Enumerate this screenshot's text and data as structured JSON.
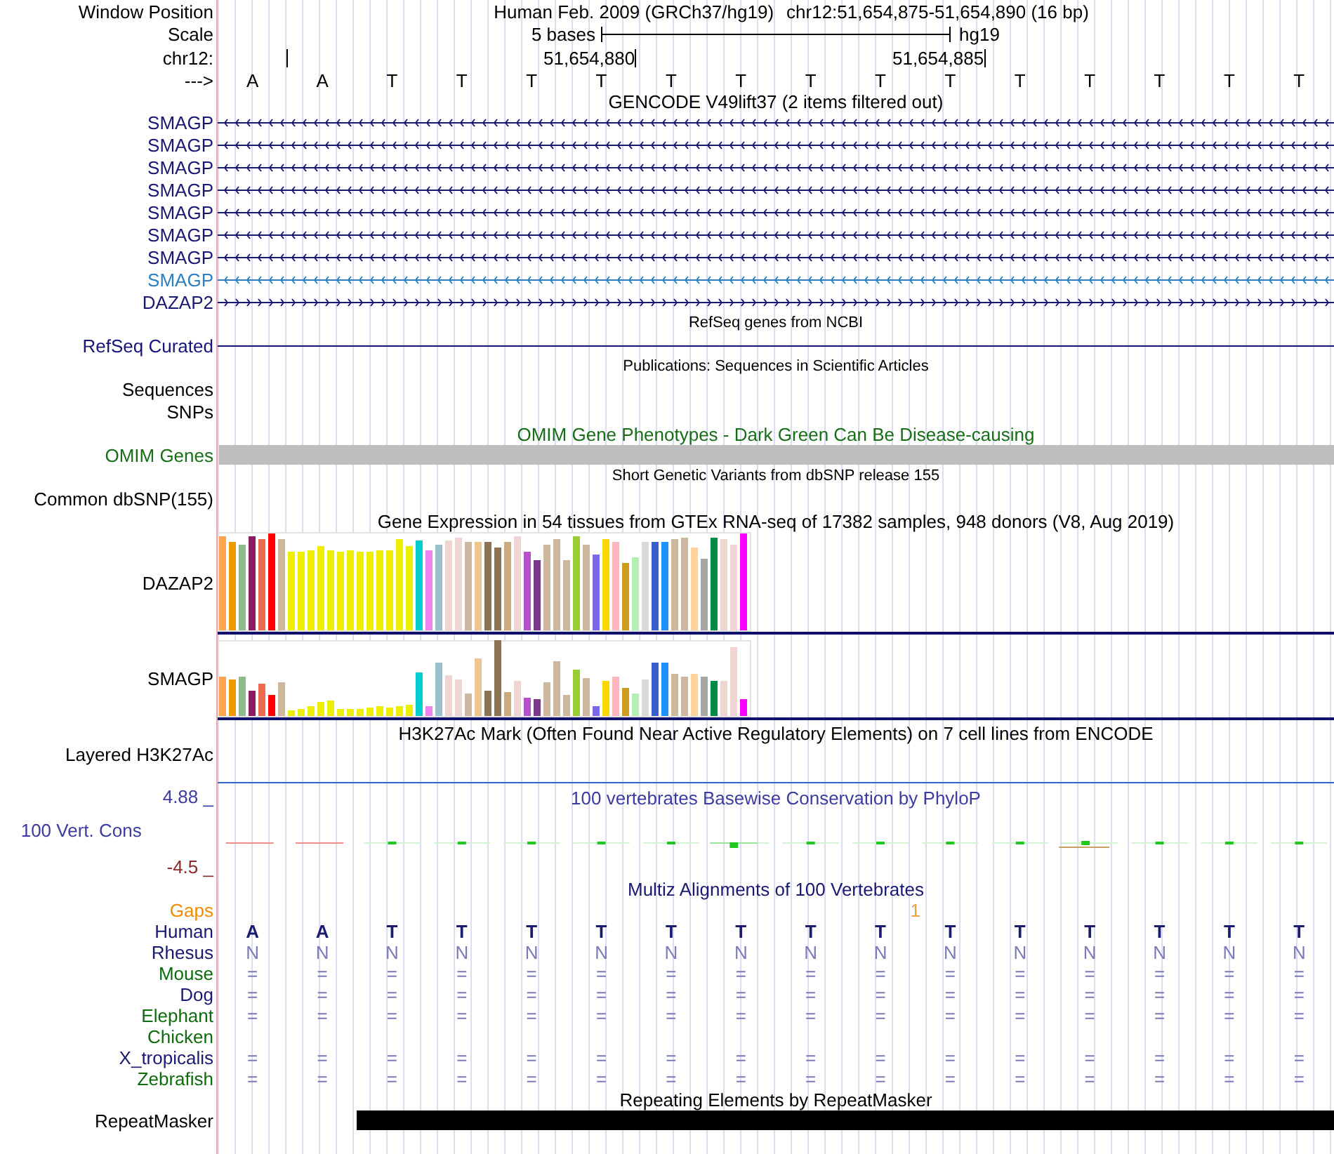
{
  "header": {
    "label": "Window Position",
    "assembly": "Human Feb. 2009 (GRCh37/hg19)",
    "position": "chr12:51,654,875-51,654,890 (16 bp)"
  },
  "scale": {
    "label": "Scale",
    "bar_label": "5 bases",
    "assembly": "hg19"
  },
  "ruler": {
    "label": "chr12:",
    "ticks": [
      {
        "kind": "minor"
      },
      {
        "kind": "major",
        "label": "51,654,880"
      },
      {
        "kind": "major",
        "label": "51,654,885"
      }
    ]
  },
  "sequence": {
    "label": "--->",
    "bases": [
      "A",
      "A",
      "T",
      "T",
      "T",
      "T",
      "T",
      "T",
      "T",
      "T",
      "T",
      "T",
      "T",
      "T",
      "T",
      "T"
    ]
  },
  "gencode": {
    "title": "GENCODE V49lift37 (2 items filtered out)",
    "transcripts": [
      {
        "name": "SMAGP",
        "color": "#191970",
        "reverse": true
      },
      {
        "name": "SMAGP",
        "color": "#191970",
        "reverse": true
      },
      {
        "name": "SMAGP",
        "color": "#191970",
        "reverse": true
      },
      {
        "name": "SMAGP",
        "color": "#191970",
        "reverse": true
      },
      {
        "name": "SMAGP",
        "color": "#191970",
        "reverse": true
      },
      {
        "name": "SMAGP",
        "color": "#191970",
        "reverse": true
      },
      {
        "name": "SMAGP",
        "color": "#191970",
        "reverse": true
      },
      {
        "name": "SMAGP",
        "color": "#2d7fc1",
        "reverse": true
      },
      {
        "name": "DAZAP2",
        "color": "#191970",
        "reverse": false
      }
    ]
  },
  "refseq": {
    "title": "RefSeq genes from NCBI",
    "label": "RefSeq Curated"
  },
  "publications": {
    "title": "Publications: Sequences in Scientific Articles",
    "subtracks": [
      "Sequences",
      "SNPs"
    ]
  },
  "omim": {
    "title": "OMIM Gene Phenotypes - Dark Green Can Be Disease-causing",
    "label": "OMIM Genes"
  },
  "dbsnp": {
    "title": "Short Genetic Variants from dbSNP release 155",
    "label": "Common dbSNP(155)"
  },
  "gtex": {
    "title": "Gene Expression in 54 tissues from GTEx RNA-seq of 17382 samples, 948 donors (V8, Aug 2019)",
    "genes": [
      "DAZAP2",
      "SMAGP"
    ]
  },
  "h3k27ac": {
    "title": "H3K27Ac Mark (Often Found Near Active Regulatory Elements) on 7 cell lines from ENCODE",
    "label": "Layered H3K27Ac"
  },
  "phylop": {
    "title": "100 vertebrates Basewise Conservation by PhyloP",
    "label": "100 Vert. Cons",
    "max_label": "4.88 _",
    "min_label": "-4.5 _"
  },
  "multiz": {
    "title": "Multiz Alignments of 100 Vertebrates",
    "gaps": {
      "label": "Gaps",
      "count": "1"
    },
    "species": [
      {
        "name": "Human",
        "color": "#191970",
        "kind": "reference",
        "bases": [
          "A",
          "A",
          "T",
          "T",
          "T",
          "T",
          "T",
          "T",
          "T",
          "T",
          "T",
          "T",
          "T",
          "T",
          "T",
          "T"
        ]
      },
      {
        "name": "Rhesus",
        "color": "#191970",
        "kind": "aligned",
        "bases": [
          "N",
          "N",
          "N",
          "N",
          "N",
          "N",
          "N",
          "N",
          "N",
          "N",
          "N",
          "N",
          "N",
          "N",
          "N",
          "N"
        ]
      },
      {
        "name": "Mouse",
        "color": "#0d6b0d",
        "kind": "aligned",
        "bases": [
          "=",
          "=",
          "=",
          "=",
          "=",
          "=",
          "=",
          "=",
          "=",
          "=",
          "=",
          "=",
          "=",
          "=",
          "=",
          "="
        ]
      },
      {
        "name": "Dog",
        "color": "#191970",
        "kind": "aligned",
        "bases": [
          "=",
          "=",
          "=",
          "=",
          "=",
          "=",
          "=",
          "=",
          "=",
          "=",
          "=",
          "=",
          "=",
          "=",
          "=",
          "="
        ]
      },
      {
        "name": "Elephant",
        "color": "#0d6b0d",
        "kind": "aligned",
        "bases": [
          "=",
          "=",
          "=",
          "=",
          "=",
          "=",
          "=",
          "=",
          "=",
          "=",
          "=",
          "=",
          "=",
          "=",
          "=",
          "="
        ]
      },
      {
        "name": "Chicken",
        "color": "#0d6b0d"
      },
      {
        "name": "X_tropicalis",
        "color": "#191970",
        "kind": "aligned",
        "bases": [
          "=",
          "=",
          "=",
          "=",
          "=",
          "=",
          "=",
          "=",
          "=",
          "=",
          "=",
          "=",
          "=",
          "=",
          "=",
          "="
        ]
      },
      {
        "name": "Zebrafish",
        "color": "#0d6b0d",
        "kind": "aligned",
        "bases": [
          "=",
          "=",
          "=",
          "=",
          "=",
          "=",
          "=",
          "=",
          "=",
          "=",
          "=",
          "=",
          "=",
          "=",
          "=",
          "="
        ]
      }
    ]
  },
  "repeatmasker": {
    "title": "Repeating Elements by RepeatMasker",
    "label": "RepeatMasker"
  }
}
